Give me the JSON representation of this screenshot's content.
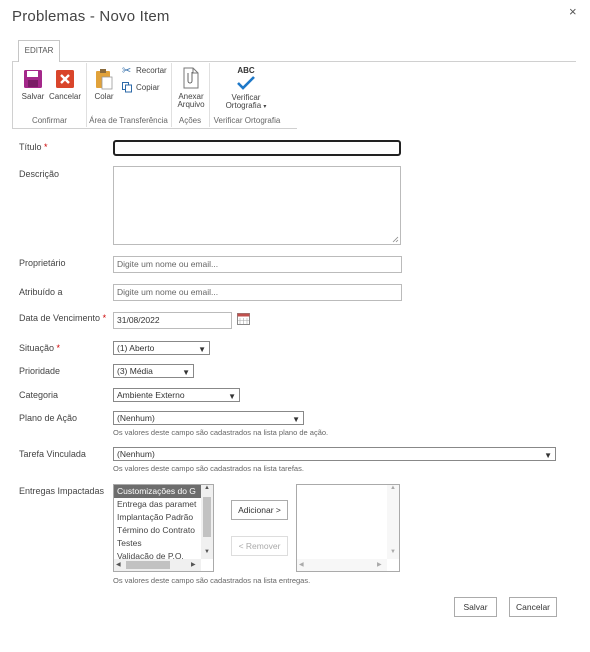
{
  "dialog": {
    "title": "Problemas - Novo Item",
    "close_glyph": "×"
  },
  "ribbon": {
    "tab": "EDITAR",
    "buttons": {
      "salvar": "Salvar",
      "cancelar": "Cancelar",
      "colar": "Colar",
      "recortar": "Recortar",
      "copiar": "Copiar",
      "anexar_1": "Anexar",
      "anexar_2": "Arquivo",
      "verificar_1": "Verificar",
      "verificar_2": "Ortografia",
      "abc": "ABC"
    },
    "groups": {
      "confirmar": "Confirmar",
      "transferencia": "Área de Transferência",
      "acoes": "Ações",
      "ortografia": "Verificar Ortografia"
    }
  },
  "form": {
    "required_mark": "*",
    "titulo": {
      "label": "Título",
      "value": ""
    },
    "descricao": {
      "label": "Descrição",
      "value": ""
    },
    "proprietario": {
      "label": "Proprietário",
      "placeholder": "Digite um nome ou email..."
    },
    "atribuido": {
      "label": "Atribuído a",
      "placeholder": "Digite um nome ou email..."
    },
    "vencimento": {
      "label": "Data de Vencimento",
      "value": "31/08/2022"
    },
    "situacao": {
      "label": "Situação",
      "value": "(1) Aberto"
    },
    "prioridade": {
      "label": "Prioridade",
      "value": "(3) Média"
    },
    "categoria": {
      "label": "Categoria",
      "value": "Ambiente Externo"
    },
    "plano": {
      "label": "Plano de Ação",
      "value": "(Nenhum)",
      "hint": "Os valores deste campo são cadastrados na lista plano de ação."
    },
    "tarefa": {
      "label": "Tarefa Vinculada",
      "value": "(Nenhum)",
      "hint": "Os valores deste campo são cadastrados na lista tarefas."
    },
    "entregas": {
      "label": "Entregas Impactadas",
      "available": [
        "Customizações do G",
        "Entrega das paramet",
        "Implantação Padrão",
        "Término do Contrato",
        "Testes",
        "Validação de P.O."
      ],
      "selected_index": 0,
      "add_button": "Adicionar >",
      "remove_button": "< Remover",
      "hint": "Os valores deste campo são cadastrados na lista entregas."
    }
  },
  "footer": {
    "save": "Salvar",
    "cancel": "Cancelar"
  },
  "colors": {
    "required": "#cc0000",
    "save_icon": "#a4288a",
    "cancel_icon": "#d9452b",
    "check": "#1e78c8",
    "selected_bg": "#6d6d6d"
  }
}
